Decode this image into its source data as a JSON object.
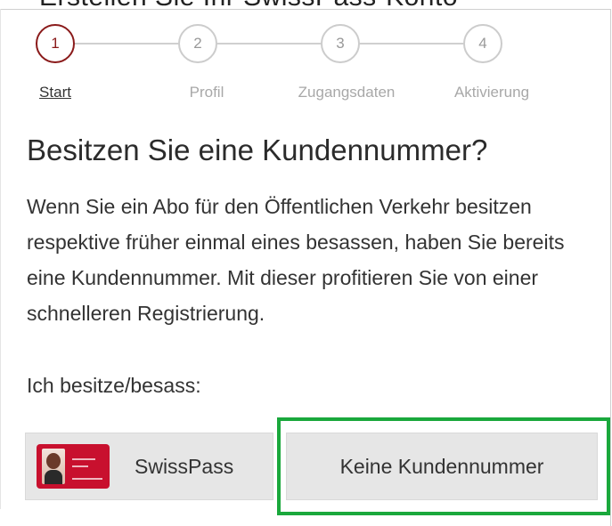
{
  "header": {
    "cut_title": "Erstellen Sie Ihr SwissPass-Konto"
  },
  "stepper": {
    "steps": [
      {
        "number": "1",
        "label": "Start",
        "active": true
      },
      {
        "number": "2",
        "label": "Profil",
        "active": false
      },
      {
        "number": "3",
        "label": "Zugangsdaten",
        "active": false
      },
      {
        "number": "4",
        "label": "Aktivierung",
        "active": false
      }
    ]
  },
  "main": {
    "title": "Besitzen Sie eine Kundennummer?",
    "intro": "Wenn Sie ein Abo für den Öffentlichen Verkehr besitzen respektive früher einmal eines besassen, haben Sie bereits eine Kundennummer. Mit dieser profitieren Sie von einer schnelleren Registrierung.",
    "owns_label": "Ich besitze/besass:",
    "options": {
      "swisspass_label": "SwissPass",
      "none_label": "Keine Kundennummer"
    }
  },
  "colors": {
    "active_step": "#8a1a1a",
    "highlight": "#1aa83c",
    "card": "#c8102e"
  }
}
